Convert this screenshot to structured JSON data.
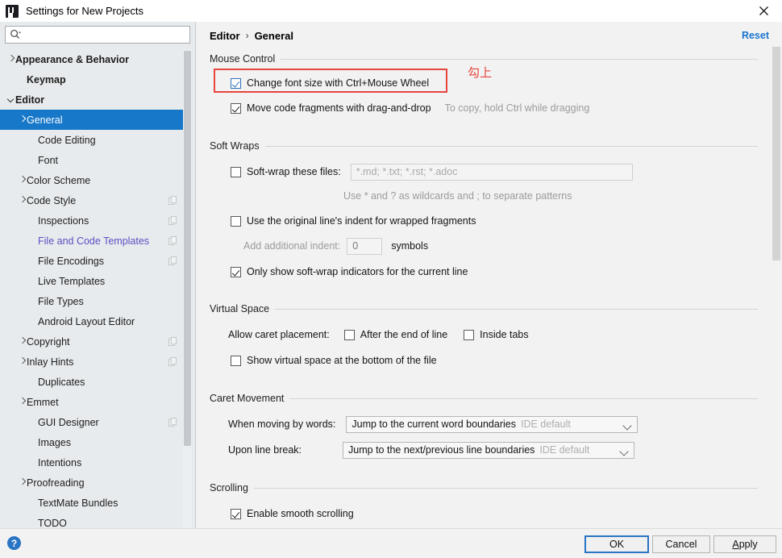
{
  "window": {
    "title": "Settings for New Projects",
    "app_icon": "intellij-idea-icon",
    "close_icon": "close-icon"
  },
  "search": {
    "icon": "search-icon",
    "value": "",
    "placeholder": ""
  },
  "sidebar": {
    "items": [
      {
        "label": "Appearance & Behavior",
        "arrow": "collapsed",
        "indent": 8,
        "bold": true,
        "selected": false,
        "link": false,
        "copy": false
      },
      {
        "label": "Keymap",
        "arrow": "none",
        "indent": 22,
        "bold": true,
        "selected": false,
        "link": false,
        "copy": false
      },
      {
        "label": "Editor",
        "arrow": "expanded",
        "indent": 8,
        "bold": true,
        "selected": false,
        "link": false,
        "copy": false
      },
      {
        "label": "General",
        "arrow": "collapsed",
        "indent": 22,
        "bold": false,
        "selected": true,
        "link": false,
        "copy": false
      },
      {
        "label": "Code Editing",
        "arrow": "none",
        "indent": 36,
        "bold": false,
        "selected": false,
        "link": false,
        "copy": false
      },
      {
        "label": "Font",
        "arrow": "none",
        "indent": 36,
        "bold": false,
        "selected": false,
        "link": false,
        "copy": false
      },
      {
        "label": "Color Scheme",
        "arrow": "collapsed",
        "indent": 22,
        "bold": false,
        "selected": false,
        "link": false,
        "copy": false
      },
      {
        "label": "Code Style",
        "arrow": "collapsed",
        "indent": 22,
        "bold": false,
        "selected": false,
        "link": false,
        "copy": true
      },
      {
        "label": "Inspections",
        "arrow": "none",
        "indent": 36,
        "bold": false,
        "selected": false,
        "link": false,
        "copy": true
      },
      {
        "label": "File and Code Templates",
        "arrow": "none",
        "indent": 36,
        "bold": false,
        "selected": false,
        "link": true,
        "copy": true
      },
      {
        "label": "File Encodings",
        "arrow": "none",
        "indent": 36,
        "bold": false,
        "selected": false,
        "link": false,
        "copy": true
      },
      {
        "label": "Live Templates",
        "arrow": "none",
        "indent": 36,
        "bold": false,
        "selected": false,
        "link": false,
        "copy": false
      },
      {
        "label": "File Types",
        "arrow": "none",
        "indent": 36,
        "bold": false,
        "selected": false,
        "link": false,
        "copy": false
      },
      {
        "label": "Android Layout Editor",
        "arrow": "none",
        "indent": 36,
        "bold": false,
        "selected": false,
        "link": false,
        "copy": false
      },
      {
        "label": "Copyright",
        "arrow": "collapsed",
        "indent": 22,
        "bold": false,
        "selected": false,
        "link": false,
        "copy": true
      },
      {
        "label": "Inlay Hints",
        "arrow": "collapsed",
        "indent": 22,
        "bold": false,
        "selected": false,
        "link": false,
        "copy": true
      },
      {
        "label": "Duplicates",
        "arrow": "none",
        "indent": 36,
        "bold": false,
        "selected": false,
        "link": false,
        "copy": false
      },
      {
        "label": "Emmet",
        "arrow": "collapsed",
        "indent": 22,
        "bold": false,
        "selected": false,
        "link": false,
        "copy": false
      },
      {
        "label": "GUI Designer",
        "arrow": "none",
        "indent": 36,
        "bold": false,
        "selected": false,
        "link": false,
        "copy": true
      },
      {
        "label": "Images",
        "arrow": "none",
        "indent": 36,
        "bold": false,
        "selected": false,
        "link": false,
        "copy": false
      },
      {
        "label": "Intentions",
        "arrow": "none",
        "indent": 36,
        "bold": false,
        "selected": false,
        "link": false,
        "copy": false
      },
      {
        "label": "Proofreading",
        "arrow": "collapsed",
        "indent": 22,
        "bold": false,
        "selected": false,
        "link": false,
        "copy": false
      },
      {
        "label": "TextMate Bundles",
        "arrow": "none",
        "indent": 36,
        "bold": false,
        "selected": false,
        "link": false,
        "copy": false
      },
      {
        "label": "TODO",
        "arrow": "none",
        "indent": 36,
        "bold": false,
        "selected": false,
        "link": false,
        "copy": false
      }
    ]
  },
  "header": {
    "breadcrumb_root": "Editor",
    "breadcrumb_separator": "›",
    "breadcrumb_leaf": "General",
    "reset_label": "Reset"
  },
  "sections": {
    "mouse_control": {
      "title": "Mouse Control",
      "change_font_size": {
        "label": "Change font size with Ctrl+Mouse Wheel",
        "checked": true
      },
      "move_code_fragments": {
        "label": "Move code fragments with drag-and-drop",
        "checked": true
      },
      "drag_hint": "To copy, hold Ctrl while dragging"
    },
    "soft_wraps": {
      "title": "Soft Wraps",
      "soft_wrap_files": {
        "label": "Soft-wrap these files:",
        "checked": false
      },
      "soft_wrap_files_value": "*.md; *.txt; *.rst; *.adoc",
      "wildcards_hint": "Use * and ? as wildcards and ; to separate patterns",
      "original_indent": {
        "label": "Use the original line's indent for wrapped fragments",
        "checked": false
      },
      "additional_indent_label": "Add additional indent:",
      "additional_indent_value": "0",
      "symbols_label": "symbols",
      "only_show_indicators": {
        "label": "Only show soft-wrap indicators for the current line",
        "checked": true
      }
    },
    "virtual_space": {
      "title": "Virtual Space",
      "allow_caret_label": "Allow caret placement:",
      "after_end_of_line": {
        "label": "After the end of line",
        "checked": false
      },
      "inside_tabs": {
        "label": "Inside tabs",
        "checked": false
      },
      "show_virtual_space": {
        "label": "Show virtual space at the bottom of the file",
        "checked": false
      }
    },
    "caret_movement": {
      "title": "Caret Movement",
      "when_moving_label": "When moving by words:",
      "when_moving_value": "Jump to the current word boundaries",
      "when_moving_suffix": "IDE default",
      "upon_line_break_label": "Upon line break:",
      "upon_line_break_value": "Jump to the next/previous line boundaries",
      "upon_line_break_suffix": "IDE default"
    },
    "scrolling": {
      "title": "Scrolling",
      "smooth_scrolling": {
        "label": "Enable smooth scrolling",
        "checked": true
      }
    }
  },
  "annotation": {
    "note_text": "勾上",
    "color": "#e8453c"
  },
  "footer": {
    "help_icon": "help-icon",
    "help_glyph": "?",
    "ok_label": "OK",
    "cancel_label": "Cancel",
    "apply_mnemonic": "A",
    "apply_rest": "pply"
  }
}
